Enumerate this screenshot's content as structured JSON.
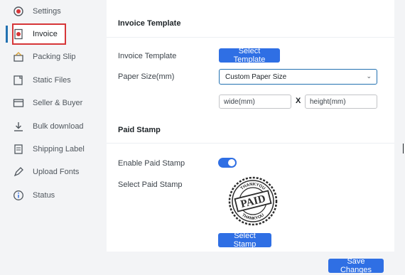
{
  "sidebar": {
    "items": [
      {
        "label": "Settings",
        "icon": "gear-icon"
      },
      {
        "label": "Invoice",
        "icon": "invoice-icon"
      },
      {
        "label": "Packing Slip",
        "icon": "package-icon"
      },
      {
        "label": "Static Files",
        "icon": "file-icon"
      },
      {
        "label": "Seller & Buyer",
        "icon": "id-card-icon"
      },
      {
        "label": "Bulk download",
        "icon": "download-icon"
      },
      {
        "label": "Shipping Label",
        "icon": "label-icon"
      },
      {
        "label": "Upload Fonts",
        "icon": "pen-icon"
      },
      {
        "label": "Status",
        "icon": "info-icon"
      }
    ],
    "active": "Invoice"
  },
  "invoice_template": {
    "section_title": "Invoice Template",
    "template_label": "Invoice Template",
    "select_template_button": "Select Template",
    "paper_size_label": "Paper Size(mm)",
    "paper_size_value": "Custom Paper Size",
    "wide_placeholder": "wide(mm)",
    "separator": "X",
    "height_placeholder": "height(mm)"
  },
  "paid_stamp": {
    "section_title": "Paid Stamp",
    "enable_label": "Enable Paid Stamp",
    "enabled": true,
    "select_label": "Select Paid Stamp",
    "stamp_text": "PAID",
    "stamp_ring_text": "THANKYOU",
    "select_stamp_button": "Select Stamp"
  },
  "footer": {
    "save_button": "Save Changes"
  },
  "colors": {
    "accent": "#2f6fe4",
    "active_border": "#d63638"
  }
}
